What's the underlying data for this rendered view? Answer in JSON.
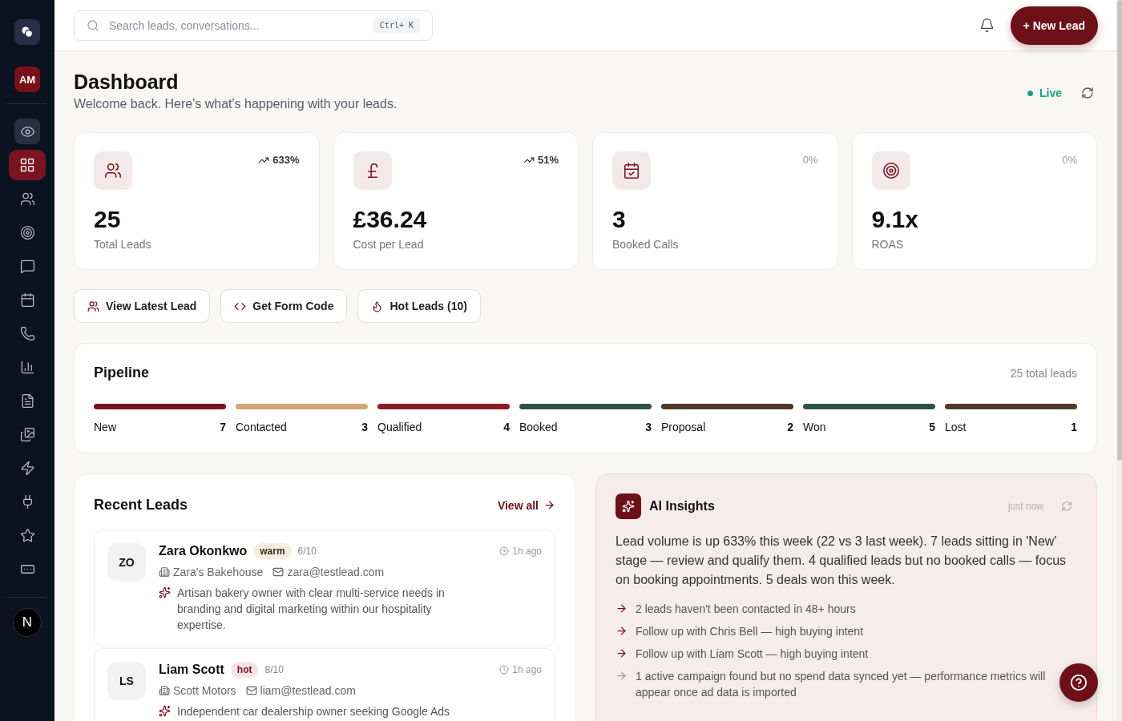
{
  "sidebar": {
    "user_initials": "AM",
    "nav_items": [
      {
        "selected": false
      },
      {
        "selected": true
      },
      {
        "selected": false
      },
      {
        "selected": false
      },
      {
        "selected": false
      },
      {
        "selected": false
      },
      {
        "selected": false
      },
      {
        "selected": false
      },
      {
        "selected": false
      },
      {
        "selected": false
      },
      {
        "selected": false
      },
      {
        "selected": false
      },
      {
        "selected": false
      },
      {
        "selected": false
      }
    ],
    "footer_initial": "N"
  },
  "header": {
    "search": {
      "placeholder": "Search leads, conversations...",
      "shortcut": "Ctrl+ K"
    },
    "new_button": "+ New Lead"
  },
  "page": {
    "title": "Dashboard",
    "subtitle": "Welcome back. Here's what's happening with your leads.",
    "status": "Live"
  },
  "stats": [
    {
      "value": "25",
      "label": "Total Leads",
      "trend": "633%",
      "kind": "up"
    },
    {
      "value": "£36.24",
      "label": "Cost per Lead",
      "trend": "51%",
      "kind": "up"
    },
    {
      "value": "3",
      "label": "Booked Calls",
      "trend": "0%",
      "kind": "flat"
    },
    {
      "value": "9.1x",
      "label": "ROAS",
      "trend": "0%",
      "kind": "flat"
    }
  ],
  "quick_actions": [
    "View Latest Lead",
    "Get Form Code",
    "Hot Leads (10)"
  ],
  "pipeline": {
    "title": "Pipeline",
    "total": "25 total leads",
    "stages": [
      {
        "name": "New",
        "count": "7",
        "color": "#7a1420"
      },
      {
        "name": "Contacted",
        "count": "3",
        "color": "#d6a574"
      },
      {
        "name": "Qualified",
        "count": "4",
        "color": "#8e1a27"
      },
      {
        "name": "Booked",
        "count": "3",
        "color": "#2e5146"
      },
      {
        "name": "Proposal",
        "count": "2",
        "color": "#4f3a2c"
      },
      {
        "name": "Won",
        "count": "5",
        "color": "#2e5146"
      },
      {
        "name": "Lost",
        "count": "1",
        "color": "#4f3a2c"
      }
    ]
  },
  "recent_leads": {
    "title": "Recent Leads",
    "view_all": "View all",
    "leads": [
      {
        "initials": "ZO",
        "name": "Zara Okonkwo",
        "temperature": "warm",
        "kind": "warm",
        "score": "6/10",
        "time": "1h ago",
        "company": "Zara's Bakehouse",
        "email": "zara@testlead.com",
        "summary": "Artisan bakery owner with clear multi-service needs in branding and digital marketing within our hospitality expertise."
      },
      {
        "initials": "LS",
        "name": "Liam Scott",
        "temperature": "hot",
        "kind": "hot",
        "score": "8/10",
        "time": "1h ago",
        "company": "Scott Motors",
        "email": "liam@testlead.com",
        "summary": "Independent car dealership owner seeking Google Ads"
      }
    ]
  },
  "ai_insights": {
    "title": "AI Insights",
    "updated": "just now",
    "summary": "Lead volume is up 633% this week (22 vs 3 last week). 7 leads sitting in 'New' stage — review and qualify them. 4 qualified leads but no booked calls — focus on booking appointments. 5 deals won this week.",
    "points": [
      {
        "text": "2 leads haven't been contacted in 48+ hours",
        "kind": "action"
      },
      {
        "text": "Follow up with Chris Bell — high buying intent",
        "kind": "action"
      },
      {
        "text": "Follow up with Liam Scott — high buying intent",
        "kind": "action"
      },
      {
        "text": "1 active campaign found but no spend data synced yet — performance metrics will appear once ad data is imported",
        "kind": "info"
      }
    ]
  }
}
